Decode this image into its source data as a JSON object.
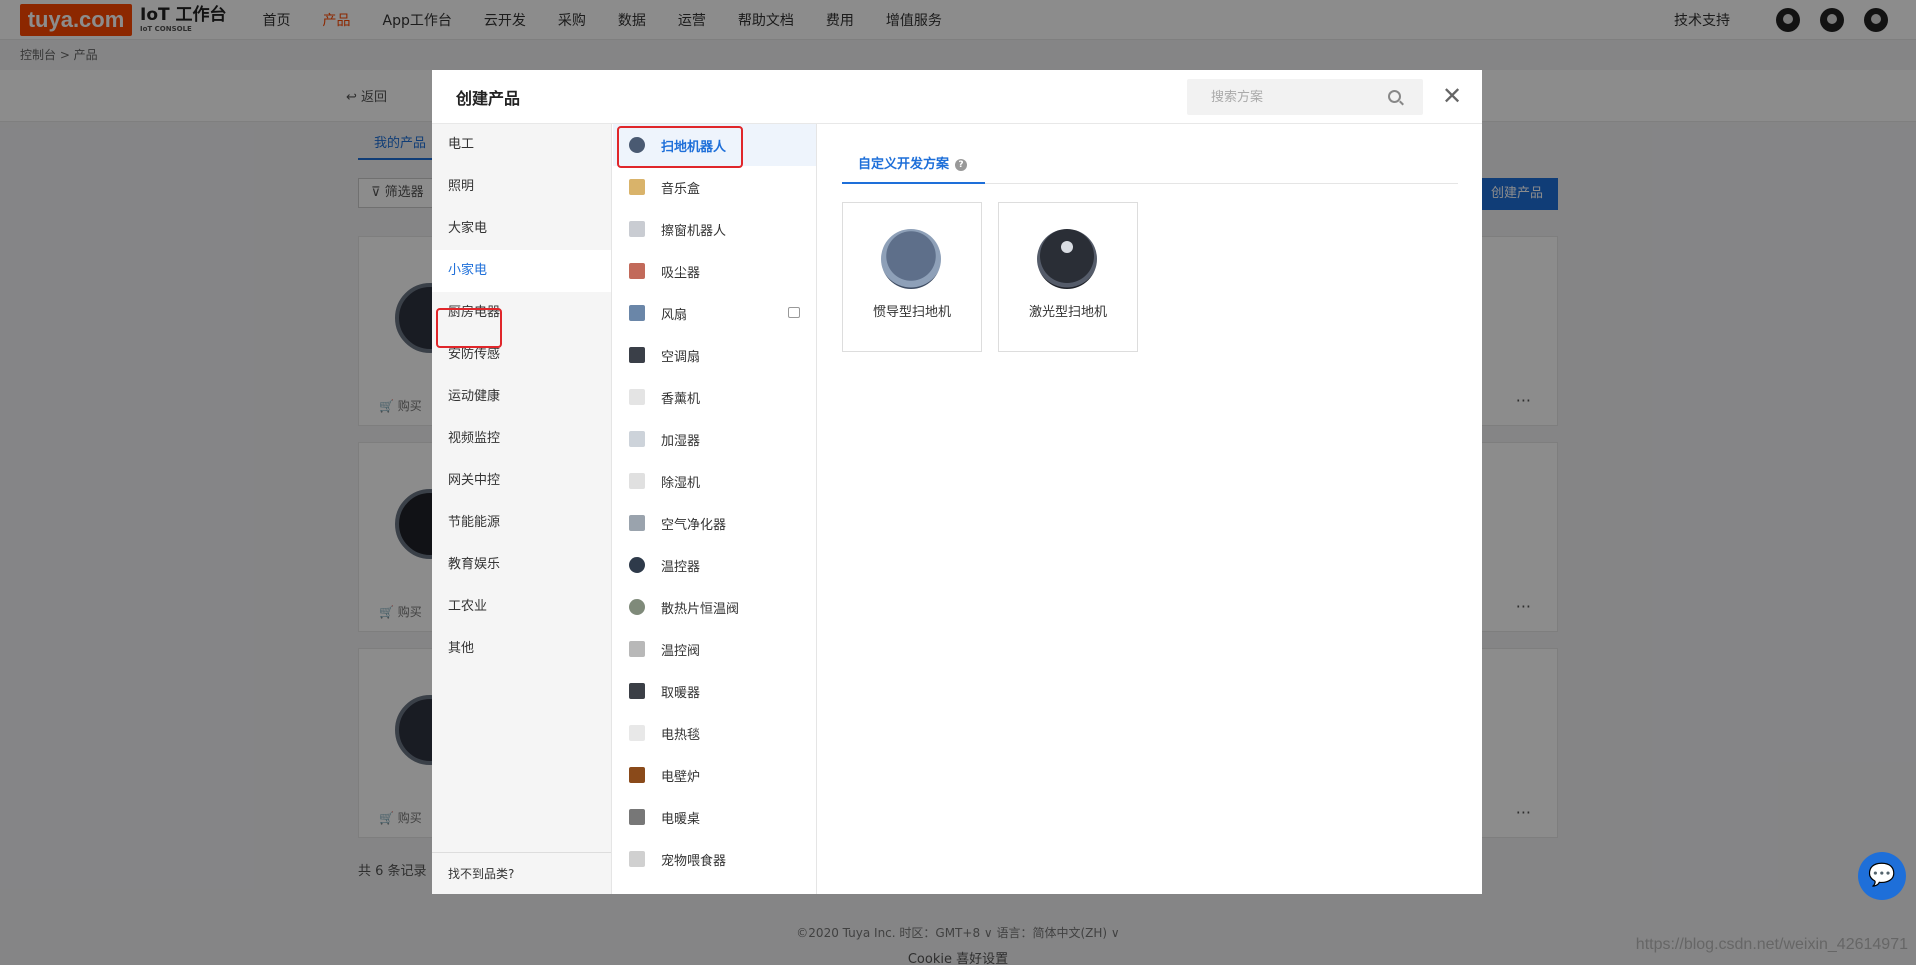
{
  "app": {
    "logo_text": "tuya.com",
    "title": "IoT 工作台",
    "subtitle": "IoT CONSOLE",
    "nav": [
      "首页",
      "产品",
      "App工作台",
      "云开发",
      "采购",
      "数据",
      "运营",
      "帮助文档",
      "费用",
      "增值服务"
    ],
    "nav_active": "产品",
    "support_label": "技术支持"
  },
  "breadcrumb": "控制台 > 产品",
  "background": {
    "back_label": "返回",
    "tab_label": "我的产品",
    "filter_label": "筛选器",
    "create_label": "创建产品",
    "buy_label": "购买",
    "record_count": "共 6 条记录",
    "footer_line1": "©2020 Tuya Inc.   时区：GMT+8 ∨   语言：简体中文(ZH) ∨",
    "footer_line2": "Cookie 喜好设置",
    "watermark": "https://blog.csdn.net/weixin_42614971"
  },
  "modal": {
    "title": "创建产品",
    "search_placeholder": "搜索方案",
    "categories": [
      "电工",
      "照明",
      "大家电",
      "小家电",
      "厨房电器",
      "安防传感",
      "运动健康",
      "视频监控",
      "网关中控",
      "节能能源",
      "教育娱乐",
      "工农业",
      "其他"
    ],
    "active_category": "小家电",
    "category_footer": "找不到品类?",
    "subcategories": [
      {
        "label": "扫地机器人",
        "icon": "robot-vacuum-icon",
        "color": "#4a5a72"
      },
      {
        "label": "音乐盒",
        "icon": "music-box-icon",
        "color": "#d9b36a"
      },
      {
        "label": "擦窗机器人",
        "icon": "window-robot-icon",
        "color": "#c9ccd2"
      },
      {
        "label": "吸尘器",
        "icon": "vacuum-cleaner-icon",
        "color": "#c26a5a"
      },
      {
        "label": "风扇",
        "icon": "fan-icon",
        "color": "#6a86a8"
      },
      {
        "label": "空调扇",
        "icon": "air-cooler-icon",
        "color": "#3a3f48"
      },
      {
        "label": "香薰机",
        "icon": "aroma-diffuser-icon",
        "color": "#e4e4e4"
      },
      {
        "label": "加湿器",
        "icon": "humidifier-icon",
        "color": "#cdd3da"
      },
      {
        "label": "除湿机",
        "icon": "dehumidifier-icon",
        "color": "#e0e0e0"
      },
      {
        "label": "空气净化器",
        "icon": "air-purifier-icon",
        "color": "#9aa3ad"
      },
      {
        "label": "温控器",
        "icon": "thermostat-icon",
        "color": "#2e3a4a"
      },
      {
        "label": "散热片恒温阀",
        "icon": "radiator-valve-icon",
        "color": "#7f8a7a"
      },
      {
        "label": "温控阀",
        "icon": "temp-valve-icon",
        "color": "#b8b8b8"
      },
      {
        "label": "取暖器",
        "icon": "heater-icon",
        "color": "#3b3f46"
      },
      {
        "label": "电热毯",
        "icon": "electric-blanket-icon",
        "color": "#e8e8e8"
      },
      {
        "label": "电壁炉",
        "icon": "fireplace-icon",
        "color": "#8a4a1a"
      },
      {
        "label": "电暖桌",
        "icon": "heating-table-icon",
        "color": "#777"
      },
      {
        "label": "宠物喂食器",
        "icon": "pet-feeder-icon",
        "color": "#d0d0d0"
      }
    ],
    "active_subcategory": "扫地机器人",
    "main_tab": "自定义开发方案",
    "solutions": [
      {
        "label": "惯导型扫地机",
        "icon": "inertial-robot-icon"
      },
      {
        "label": "激光型扫地机",
        "icon": "laser-robot-icon"
      }
    ]
  },
  "colors": {
    "accent": "#1e6fd9",
    "brand": "#ff4800",
    "highlight": "#e0262a"
  }
}
